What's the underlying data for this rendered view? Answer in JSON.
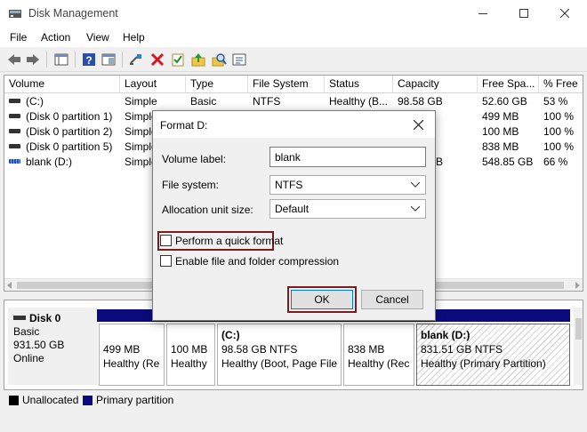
{
  "window": {
    "title": "Disk Management"
  },
  "menu": [
    "File",
    "Action",
    "View",
    "Help"
  ],
  "list": {
    "columns": [
      "Volume",
      "Layout",
      "Type",
      "File System",
      "Status",
      "Capacity",
      "Free Spa...",
      "% Free"
    ],
    "rows": [
      [
        "(C:)",
        "Simple",
        "Basic",
        "NTFS",
        "Healthy (B...",
        "98.58 GB",
        "52.60 GB",
        "53 %"
      ],
      [
        "(Disk 0 partition 1)",
        "Simple",
        "",
        "",
        "",
        "",
        "499 MB",
        "100 %"
      ],
      [
        "(Disk 0 partition 2)",
        "Simple",
        "",
        "",
        "",
        "",
        "100 MB",
        "100 %"
      ],
      [
        "(Disk 0 partition 5)",
        "Simple",
        "",
        "",
        "",
        "",
        "838 MB",
        "100 %"
      ],
      [
        "blank (D:)",
        "Simple",
        "",
        "",
        "",
        "B",
        "548.85 GB",
        "66 %"
      ]
    ]
  },
  "disk": {
    "name": "Disk 0",
    "type": "Basic",
    "size": "931.50 GB",
    "state": "Online",
    "partitions": [
      {
        "name": "",
        "size": "499 MB",
        "status": "Healthy (Re"
      },
      {
        "name": "",
        "size": "100 MB",
        "status": "Healthy"
      },
      {
        "name": "(C:)",
        "size": "98.58 GB NTFS",
        "status": "Healthy (Boot, Page File"
      },
      {
        "name": "",
        "size": "838 MB",
        "status": "Healthy (Rec"
      },
      {
        "name": "blank  (D:)",
        "size": "831.51 GB NTFS",
        "status": "Healthy (Primary Partition)"
      }
    ]
  },
  "legend": [
    {
      "label": "Unallocated",
      "color": "#000000"
    },
    {
      "label": "Primary partition",
      "color": "#0b0b7d"
    }
  ],
  "dialog": {
    "title": "Format D:",
    "volume_label_text": "Volume label:",
    "volume_label_value": "blank",
    "file_system_text": "File system:",
    "file_system_value": "NTFS",
    "alloc_text": "Allocation unit size:",
    "alloc_value": "Default",
    "quick_format_text": "Perform a quick format",
    "compression_text": "Enable file and folder compression",
    "ok_label": "OK",
    "cancel_label": "Cancel"
  },
  "colors": {
    "highlight": "#7b1b1b",
    "primary_partition": "#0b0b7d"
  }
}
